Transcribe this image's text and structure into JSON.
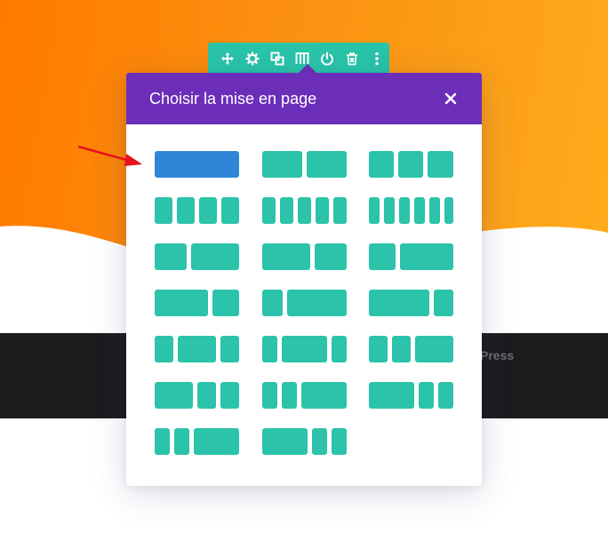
{
  "modal": {
    "title": "Choisir la mise en page",
    "close_icon": "close-icon"
  },
  "toolbar": {
    "icons": [
      "move-icon",
      "gear-icon",
      "duplicate-icon",
      "columns-icon",
      "power-icon",
      "trash-icon",
      "more-icon"
    ]
  },
  "footer": {
    "text": "rdPress"
  },
  "layouts": [
    {
      "name": "layout-1",
      "cols": [
        1
      ]
    },
    {
      "name": "layout-1-2_1-2",
      "cols": [
        1,
        1
      ]
    },
    {
      "name": "layout-1-3_1-3_1-3",
      "cols": [
        1,
        1,
        1
      ]
    },
    {
      "name": "layout-1-4x4",
      "cols": [
        1,
        1,
        1,
        1
      ]
    },
    {
      "name": "layout-1-5x5",
      "cols": [
        1,
        1,
        1,
        1,
        1
      ]
    },
    {
      "name": "layout-1-6x6",
      "cols": [
        1,
        1,
        1,
        1,
        1,
        1
      ]
    },
    {
      "name": "layout-2-5_3-5",
      "cols": [
        2,
        3
      ]
    },
    {
      "name": "layout-3-5_2-5",
      "cols": [
        3,
        2
      ]
    },
    {
      "name": "layout-1-3_2-3",
      "cols": [
        1,
        2
      ]
    },
    {
      "name": "layout-2-3_1-3",
      "cols": [
        2,
        1
      ]
    },
    {
      "name": "layout-1-4_3-4",
      "cols": [
        1,
        3
      ]
    },
    {
      "name": "layout-3-4_1-4",
      "cols": [
        3,
        1
      ]
    },
    {
      "name": "layout-1-4_1-2_1-4",
      "cols": [
        1,
        2,
        1
      ]
    },
    {
      "name": "layout-1-5_3-5_1-5",
      "cols": [
        1,
        3,
        1
      ]
    },
    {
      "name": "layout-1-4_1-4_1-2",
      "cols": [
        1,
        1,
        2
      ]
    },
    {
      "name": "layout-1-2_1-4_1-4",
      "cols": [
        2,
        1,
        1
      ]
    },
    {
      "name": "layout-1-5_1-5_3-5",
      "cols": [
        1,
        1,
        3
      ]
    },
    {
      "name": "layout-3-5_1-5_1-5",
      "cols": [
        3,
        1,
        1
      ]
    },
    {
      "name": "layout-1-6_1-6_1-2",
      "cols": [
        1,
        1,
        3
      ]
    },
    {
      "name": "layout-1-2_1-6_1-6",
      "cols": [
        3,
        1,
        1
      ]
    }
  ],
  "selected_layout": 0,
  "colors": {
    "accent_teal": "#2bc3a9",
    "selected_blue": "#2f86d9",
    "header_purple": "#6c2eb9",
    "arrow_red": "#e8101e"
  }
}
